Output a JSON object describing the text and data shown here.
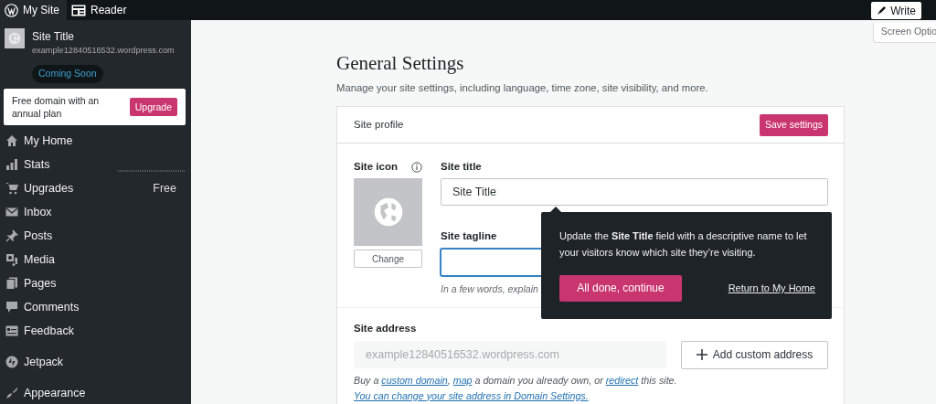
{
  "top_bar": {
    "items": [
      {
        "label": "My Site",
        "selected": true
      },
      {
        "label": "Reader",
        "selected": false
      }
    ],
    "write_button": "Write"
  },
  "screen_options": "Screen Optio",
  "sidebar": {
    "site": {
      "title": "Site Title",
      "url": "example12840516532.wordpress.com",
      "badge": "Coming Soon"
    },
    "promo": {
      "text": "Free domain with an annual plan",
      "button": "Upgrade"
    },
    "items": [
      {
        "label": "My Home"
      },
      {
        "label": "Stats"
      },
      {
        "label": "Upgrades",
        "badge": "Free"
      },
      {
        "label": "Inbox"
      },
      {
        "label": "Posts"
      },
      {
        "label": "Media"
      },
      {
        "label": "Pages"
      },
      {
        "label": "Comments"
      },
      {
        "label": "Feedback"
      },
      {
        "label": "Jetpack"
      },
      {
        "label": "Appearance"
      }
    ]
  },
  "main": {
    "title": "General Settings",
    "subtitle": "Manage your site settings, including language, time zone, site visibility, and more.",
    "card": {
      "header": "Site profile",
      "save_button": "Save settings",
      "site_icon": {
        "label": "Site icon",
        "button": "Change"
      },
      "site_title": {
        "label": "Site title",
        "value": "Site Title"
      },
      "tagline": {
        "label": "Site tagline",
        "focused": true,
        "hint": "In a few words, explain"
      },
      "site_address": {
        "label": "Site address",
        "value": "example12840516532.wordpress.com",
        "button": "Add custom address",
        "help": [
          {
            "kind": "text",
            "text": "Buy a "
          },
          {
            "kind": "link",
            "text": "custom domain"
          },
          {
            "kind": "text",
            "text": ", "
          },
          {
            "kind": "link",
            "text": "map"
          },
          {
            "kind": "text",
            "text": " a domain you already own, or "
          },
          {
            "kind": "link",
            "text": "redirect"
          },
          {
            "kind": "text",
            "text": " this site. "
          },
          {
            "kind": "link",
            "text": "You can change your site address in Domain Settings."
          }
        ]
      }
    }
  },
  "tour_tip": {
    "text": "Update the **Site Title** field with a descriptive name to let your visitors know which site they’re visiting.",
    "button": "All done, continue",
    "link": "Return to My Home"
  }
}
